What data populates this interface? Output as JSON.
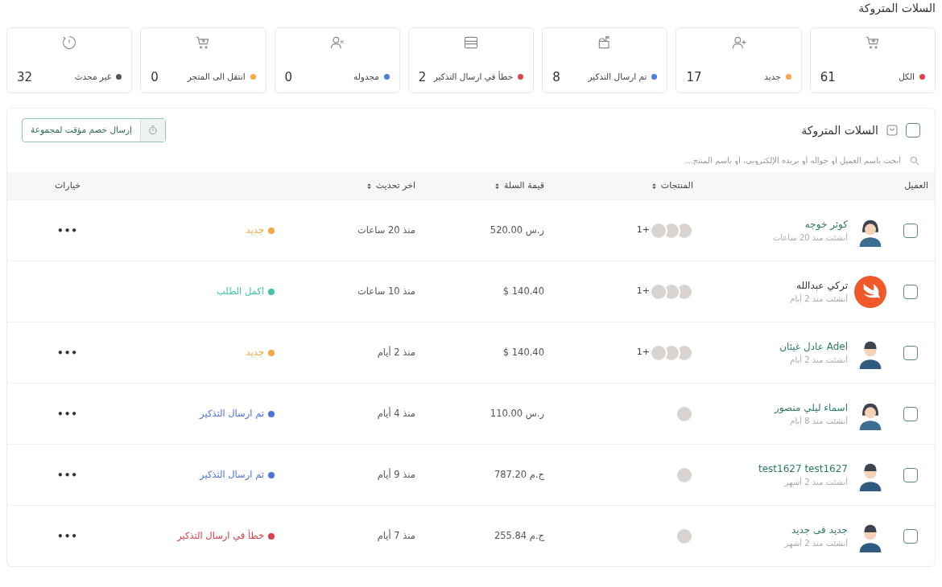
{
  "page_title": "السلات المتروكة",
  "stats": [
    {
      "kind": "cart-plus",
      "label": "الكل",
      "count": "61",
      "color": "#e0434f"
    },
    {
      "kind": "user-plus",
      "label": "جديد",
      "count": "17",
      "color": "#f5a742"
    },
    {
      "kind": "mailbox",
      "label": "تم ارسال التذكير",
      "count": "8",
      "color": "#4a7fe0"
    },
    {
      "kind": "box",
      "label": "خطأ في ارسال التذكير",
      "count": "2",
      "color": "#e0434f"
    },
    {
      "kind": "user-x",
      "label": "مجدوله",
      "count": "0",
      "color": "#4a7fe0"
    },
    {
      "kind": "cart-x",
      "label": "انتقل الى المتجر",
      "count": "0",
      "color": "#f5a742"
    },
    {
      "kind": "timer",
      "label": "غير محدث",
      "count": "32",
      "color": "#555555"
    }
  ],
  "panel": {
    "title": "السلات المتروكة",
    "select_all": {
      "checked": false
    },
    "action_button": "إرسال خصم مؤقت لمجموعة",
    "search": {
      "placeholder": "ابحث باسم العميل أو جواله أو بريده الإلكتروني، أو باسم المنتج..."
    }
  },
  "table": {
    "columns": [
      {
        "kind": "customer",
        "label": "العميل",
        "sortable": false
      },
      {
        "kind": "products",
        "label": "المنتجات",
        "sortable": true
      },
      {
        "kind": "value",
        "label": "قيمة السلة",
        "sortable": true
      },
      {
        "kind": "updated",
        "label": "اخر تحديث",
        "sortable": true
      },
      {
        "kind": "options",
        "label": "خيارات",
        "sortable": false
      }
    ],
    "rows": [
      {
        "checked": false,
        "avatar": {
          "kind": "female"
        },
        "name": "كوثر خوجه",
        "name_link": true,
        "created": "أنشئت منذ 20 ساعات",
        "products": [
          {
            "kind": "photo"
          },
          {
            "kind": "photo"
          },
          {
            "kind": "photo"
          }
        ],
        "more": "+1",
        "value": "520.00 ر.س",
        "updated": "منذ 20 ساعات",
        "status": {
          "label": "جديد",
          "color": "#f5a742"
        },
        "options": "•••"
      },
      {
        "checked": false,
        "avatar": {
          "kind": "logo"
        },
        "name": "تركي عبدالله",
        "name_link": false,
        "created": "أنشئت منذ 2 أيام",
        "products": [
          {
            "kind": "photo"
          },
          {
            "kind": "photo"
          },
          {
            "kind": "photo"
          }
        ],
        "more": "+1",
        "value": "$ 140.40",
        "updated": "منذ 10 ساعات",
        "status": {
          "label": "اكمل الطلب",
          "color": "#3fc4a8"
        }
      },
      {
        "checked": false,
        "avatar": {
          "kind": "male"
        },
        "name": "Adel عادل غيثان",
        "name_link": true,
        "created": "أنشئت منذ 2 أيام",
        "products": [
          {
            "kind": "photo"
          },
          {
            "kind": "photo"
          },
          {
            "kind": "photo"
          }
        ],
        "more": "+1",
        "value": "$ 140.40",
        "updated": "منذ 2 أيام",
        "status": {
          "label": "جديد",
          "color": "#f5a742"
        },
        "options": "•••"
      },
      {
        "checked": false,
        "avatar": {
          "kind": "female"
        },
        "name": "اسماء ليلي منصور",
        "name_link": true,
        "created": "أنشئت منذ 8 أيام",
        "products": [
          {
            "kind": "photo"
          }
        ],
        "value": "110.00 ر.س",
        "updated": "منذ 4 أيام",
        "status": {
          "label": "تم ارسال التذكير",
          "color": "#4a72e0"
        },
        "options": "•••"
      },
      {
        "checked": false,
        "avatar": {
          "kind": "male"
        },
        "name": "test1627 test1627",
        "name_link": true,
        "created": "أنشئت منذ 2 أشهر",
        "products": [
          {
            "kind": "photo"
          }
        ],
        "value": "787.20 ج.م",
        "updated": "منذ 9 أيام",
        "status": {
          "label": "تم ارسال التذكير",
          "color": "#4a72e0"
        },
        "options": "•••"
      },
      {
        "checked": false,
        "avatar": {
          "kind": "male"
        },
        "name": "جديد فى جديد",
        "name_link": true,
        "created": "أنشئت منذ 2 أشهر",
        "products": [
          {
            "kind": "photo"
          }
        ],
        "value": "255.84 ج.م",
        "updated": "منذ 7 أيام",
        "status": {
          "label": "خطأ في ارسال التذكير",
          "color": "#d9414b"
        },
        "options": "•••"
      }
    ]
  }
}
